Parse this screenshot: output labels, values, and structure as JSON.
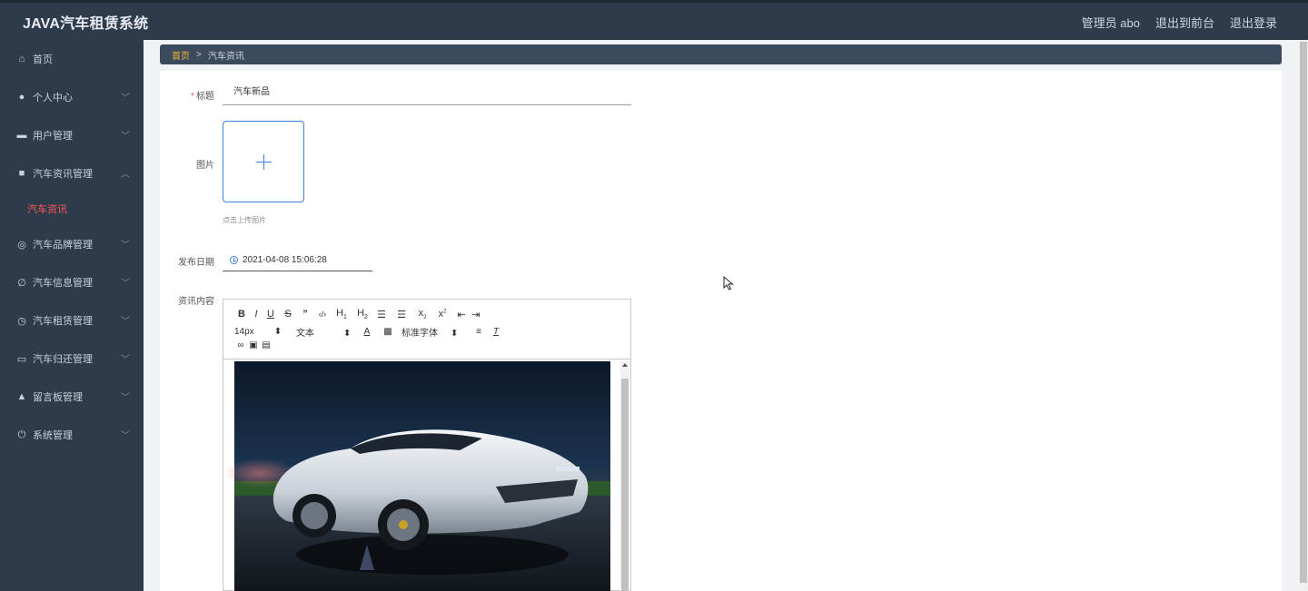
{
  "app": {
    "title": "JAVA汽车租赁系统",
    "user_label": "管理员 abo",
    "to_frontend": "退出到前台",
    "logout": "退出登录"
  },
  "sidebar": {
    "items": [
      {
        "label": "首页",
        "icon": "home-icon",
        "glyph": "⌂"
      },
      {
        "label": "个人中心",
        "icon": "user-icon",
        "glyph": "●"
      },
      {
        "label": "用户管理",
        "icon": "briefcase-icon",
        "glyph": "▬"
      },
      {
        "label": "汽车资讯管理",
        "icon": "chat-icon",
        "glyph": "■"
      },
      {
        "label": "汽车品牌管理",
        "icon": "compass-icon",
        "glyph": "◎"
      },
      {
        "label": "汽车信息管理",
        "icon": "edit-icon",
        "glyph": "∅"
      },
      {
        "label": "汽车租赁管理",
        "icon": "clock-icon",
        "glyph": "◷"
      },
      {
        "label": "汽车归还管理",
        "icon": "id-card-icon",
        "glyph": "▭"
      },
      {
        "label": "留言板管理",
        "icon": "person-icon",
        "glyph": "▲"
      },
      {
        "label": "系统管理",
        "icon": "power-icon",
        "glyph": "⏻"
      }
    ],
    "active_sub": "汽车资讯"
  },
  "breadcrumb": {
    "home": "首页",
    "separator": ">",
    "current": "汽车资讯"
  },
  "form": {
    "title_label": "标题",
    "title_value": "汽车新品",
    "image_label": "图片",
    "upload_tip": "点击上传图片",
    "date_label": "发布日期",
    "date_value": "2021-04-08 15:06:28",
    "content_label": "资讯内容"
  },
  "editor": {
    "font_size": "14px",
    "block_type": "文本",
    "font_family": "标准字体",
    "image_alt": "white sports car on wet road at night"
  }
}
